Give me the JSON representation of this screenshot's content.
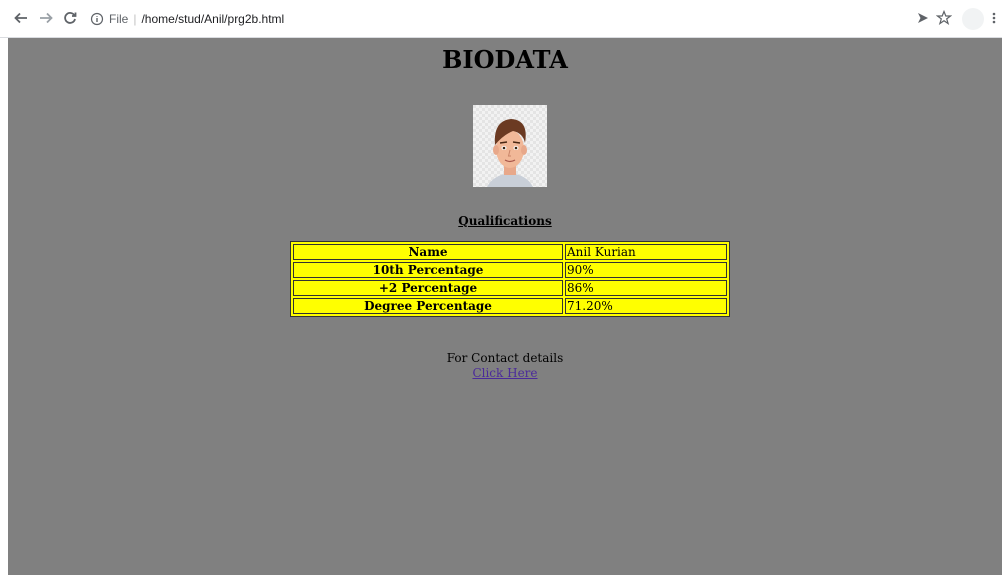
{
  "browser": {
    "url_scheme": "File",
    "url_separator": "|",
    "url_path": "/home/stud/Anil/prg2b.html"
  },
  "page": {
    "title": "BIODATA",
    "qualifications_heading": "Qualifications",
    "table": [
      {
        "label": "Name",
        "value": "Anil Kurian"
      },
      {
        "label": "10th Percentage",
        "value": "90%"
      },
      {
        "label": "+2 Percentage",
        "value": "86%"
      },
      {
        "label": "Degree Percentage",
        "value": "71.20%"
      }
    ],
    "contact_text": "For Contact details",
    "contact_link": "Click Here"
  },
  "colors": {
    "page_background": "#808080",
    "table_background": "#ffff00",
    "link": "#4b2a9a"
  }
}
